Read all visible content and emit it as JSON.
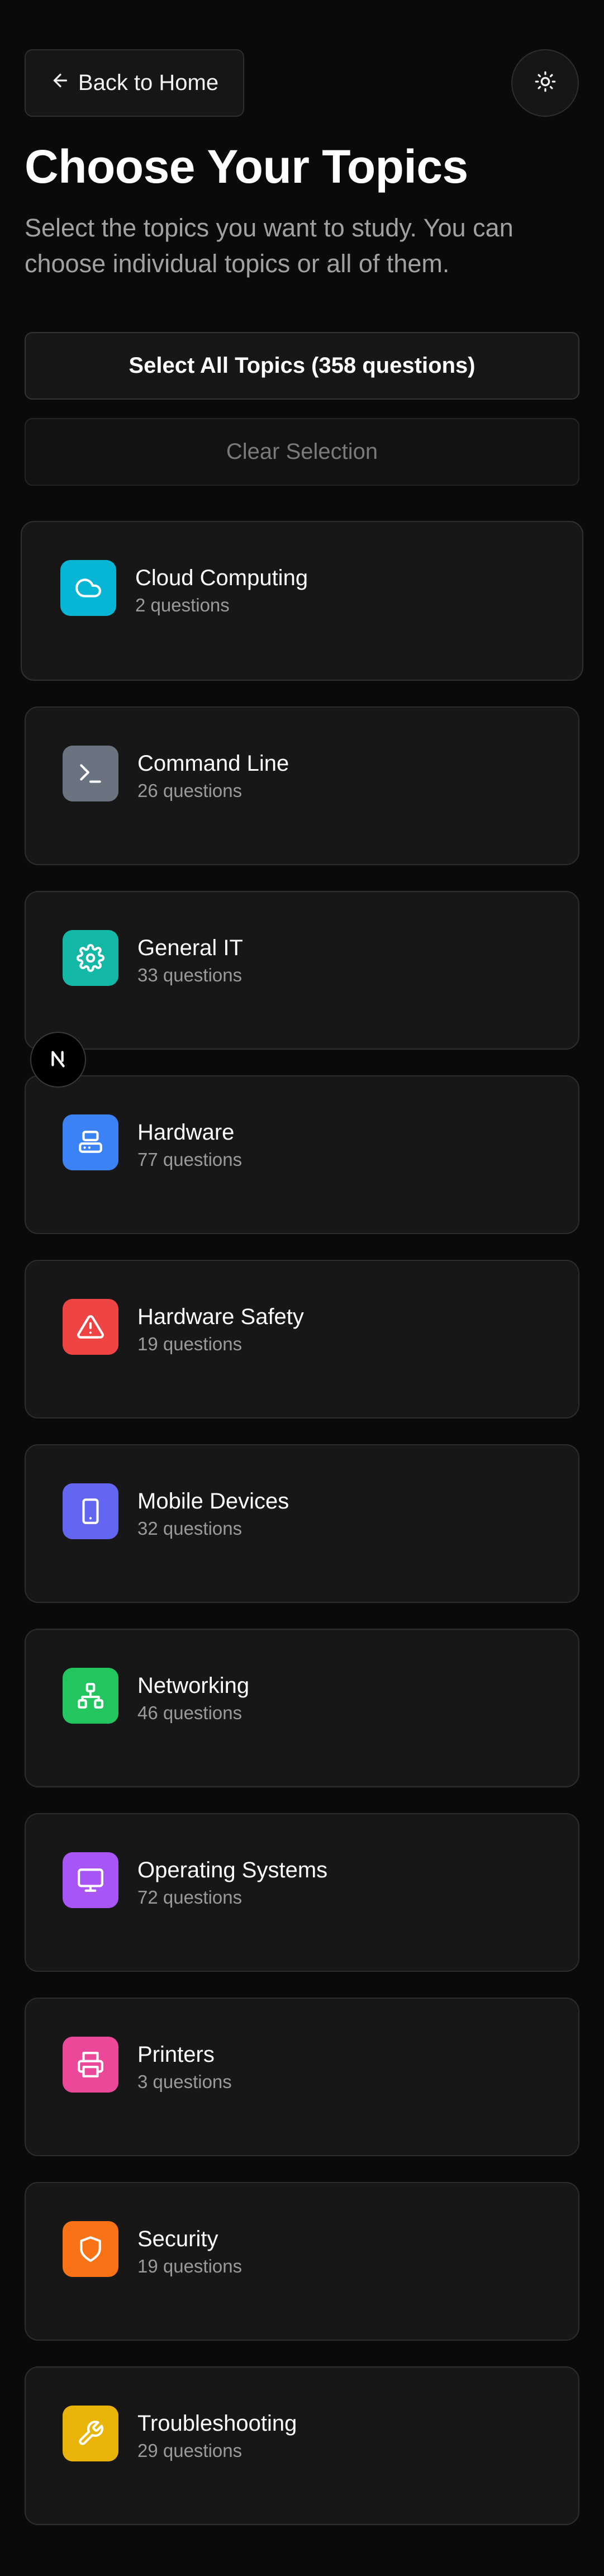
{
  "header": {
    "back_label": "Back to Home",
    "back_icon": "arrow-left-icon",
    "theme_icon": "sun-icon",
    "title": "Choose Your Topics",
    "subtitle": "Select the topics you want to study. You can choose individual topics or all of them."
  },
  "actions": {
    "select_all_label": "Select All Topics (358 questions)",
    "clear_label": "Clear Selection"
  },
  "topics": [
    {
      "name": "Cloud Computing",
      "count": "2 questions",
      "icon": "cloud-icon",
      "color": "#06b6d4"
    },
    {
      "name": "Command Line",
      "count": "26 questions",
      "icon": "terminal-icon",
      "color": "#6b7280"
    },
    {
      "name": "General IT",
      "count": "33 questions",
      "icon": "gear-icon",
      "color": "#14b8a6"
    },
    {
      "name": "Hardware",
      "count": "77 questions",
      "icon": "hard-drive-icon",
      "color": "#3b82f6"
    },
    {
      "name": "Hardware Safety",
      "count": "19 questions",
      "icon": "warning-triangle-icon",
      "color": "#ef4444"
    },
    {
      "name": "Mobile Devices",
      "count": "32 questions",
      "icon": "smartphone-icon",
      "color": "#6366f1"
    },
    {
      "name": "Networking",
      "count": "46 questions",
      "icon": "network-icon",
      "color": "#22c55e"
    },
    {
      "name": "Operating Systems",
      "count": "72 questions",
      "icon": "monitor-icon",
      "color": "#a855f7"
    },
    {
      "name": "Printers",
      "count": "3 questions",
      "icon": "printer-icon",
      "color": "#ec4899"
    },
    {
      "name": "Security",
      "count": "19 questions",
      "icon": "shield-icon",
      "color": "#f97316"
    },
    {
      "name": "Troubleshooting",
      "count": "29 questions",
      "icon": "wrench-icon",
      "color": "#eab308"
    }
  ],
  "overlay": {
    "badge_icon": "nextjs-logo-icon"
  }
}
